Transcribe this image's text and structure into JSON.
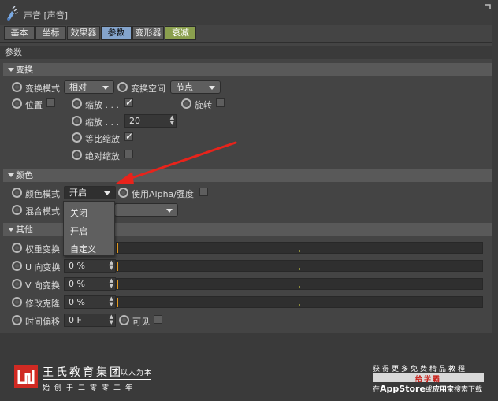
{
  "window": {
    "title": "声音 [声音]"
  },
  "tabs": [
    {
      "label": "基本"
    },
    {
      "label": "坐标"
    },
    {
      "label": "效果器"
    },
    {
      "label": "参数"
    },
    {
      "label": "变形器"
    },
    {
      "label": "衰减"
    }
  ],
  "params_header": "参数",
  "sections": {
    "transform": {
      "title": "变换"
    },
    "color": {
      "title": "颜色"
    },
    "other": {
      "title": "其他"
    }
  },
  "transform": {
    "mode_label": "变换模式",
    "mode_value": "相对",
    "space_label": "变换空间",
    "space_value": "节点",
    "position_label": "位置",
    "position_checked": false,
    "scale_label": "缩放 . . .",
    "scale_checked": true,
    "rotate_label": "旋转",
    "rotate_checked": false,
    "scale_amount_label": "缩放 . . .",
    "scale_amount_value": "20",
    "uniform_scale_label": "等比缩放",
    "uniform_scale_checked": true,
    "absolute_scale_label": "绝对缩放",
    "absolute_scale_checked": false
  },
  "color": {
    "mode_label": "颜色模式",
    "mode_value": "开启",
    "use_alpha_label": "使用Alpha/强度",
    "use_alpha_checked": false,
    "blend_label": "混合模式",
    "menu_options": [
      "关闭",
      "开启",
      "自定义"
    ]
  },
  "other": {
    "weight_label": "权重变换",
    "u_label": "U 向变换",
    "u_value": "0 %",
    "v_label": "V 向变换",
    "v_value": "0 %",
    "clone_label": "修改克隆",
    "clone_value": "0 %",
    "time_label": "时间偏移",
    "time_value": "0 F",
    "visible_label": "可见",
    "visible_checked": false
  },
  "watermark": {
    "brand": "王氏教育集团",
    "slogan": "以人为本",
    "subline": "始创于二零零二年",
    "ad_top": "获得更多免费精品教程",
    "ad_badge": "给学霸",
    "ad_bottom_prefix": "在",
    "ad_bottom_store": "AppStore",
    "ad_bottom_mid": "或",
    "ad_bottom_app": "应用宝",
    "ad_bottom_suffix": "搜索下载"
  },
  "colors": {
    "active_tab": "#84a4cc",
    "accent_tab": "#8a9f4e",
    "arrow": "#e8231b",
    "timeline_marker": "#e39a1f",
    "logo": "#d02a23"
  }
}
